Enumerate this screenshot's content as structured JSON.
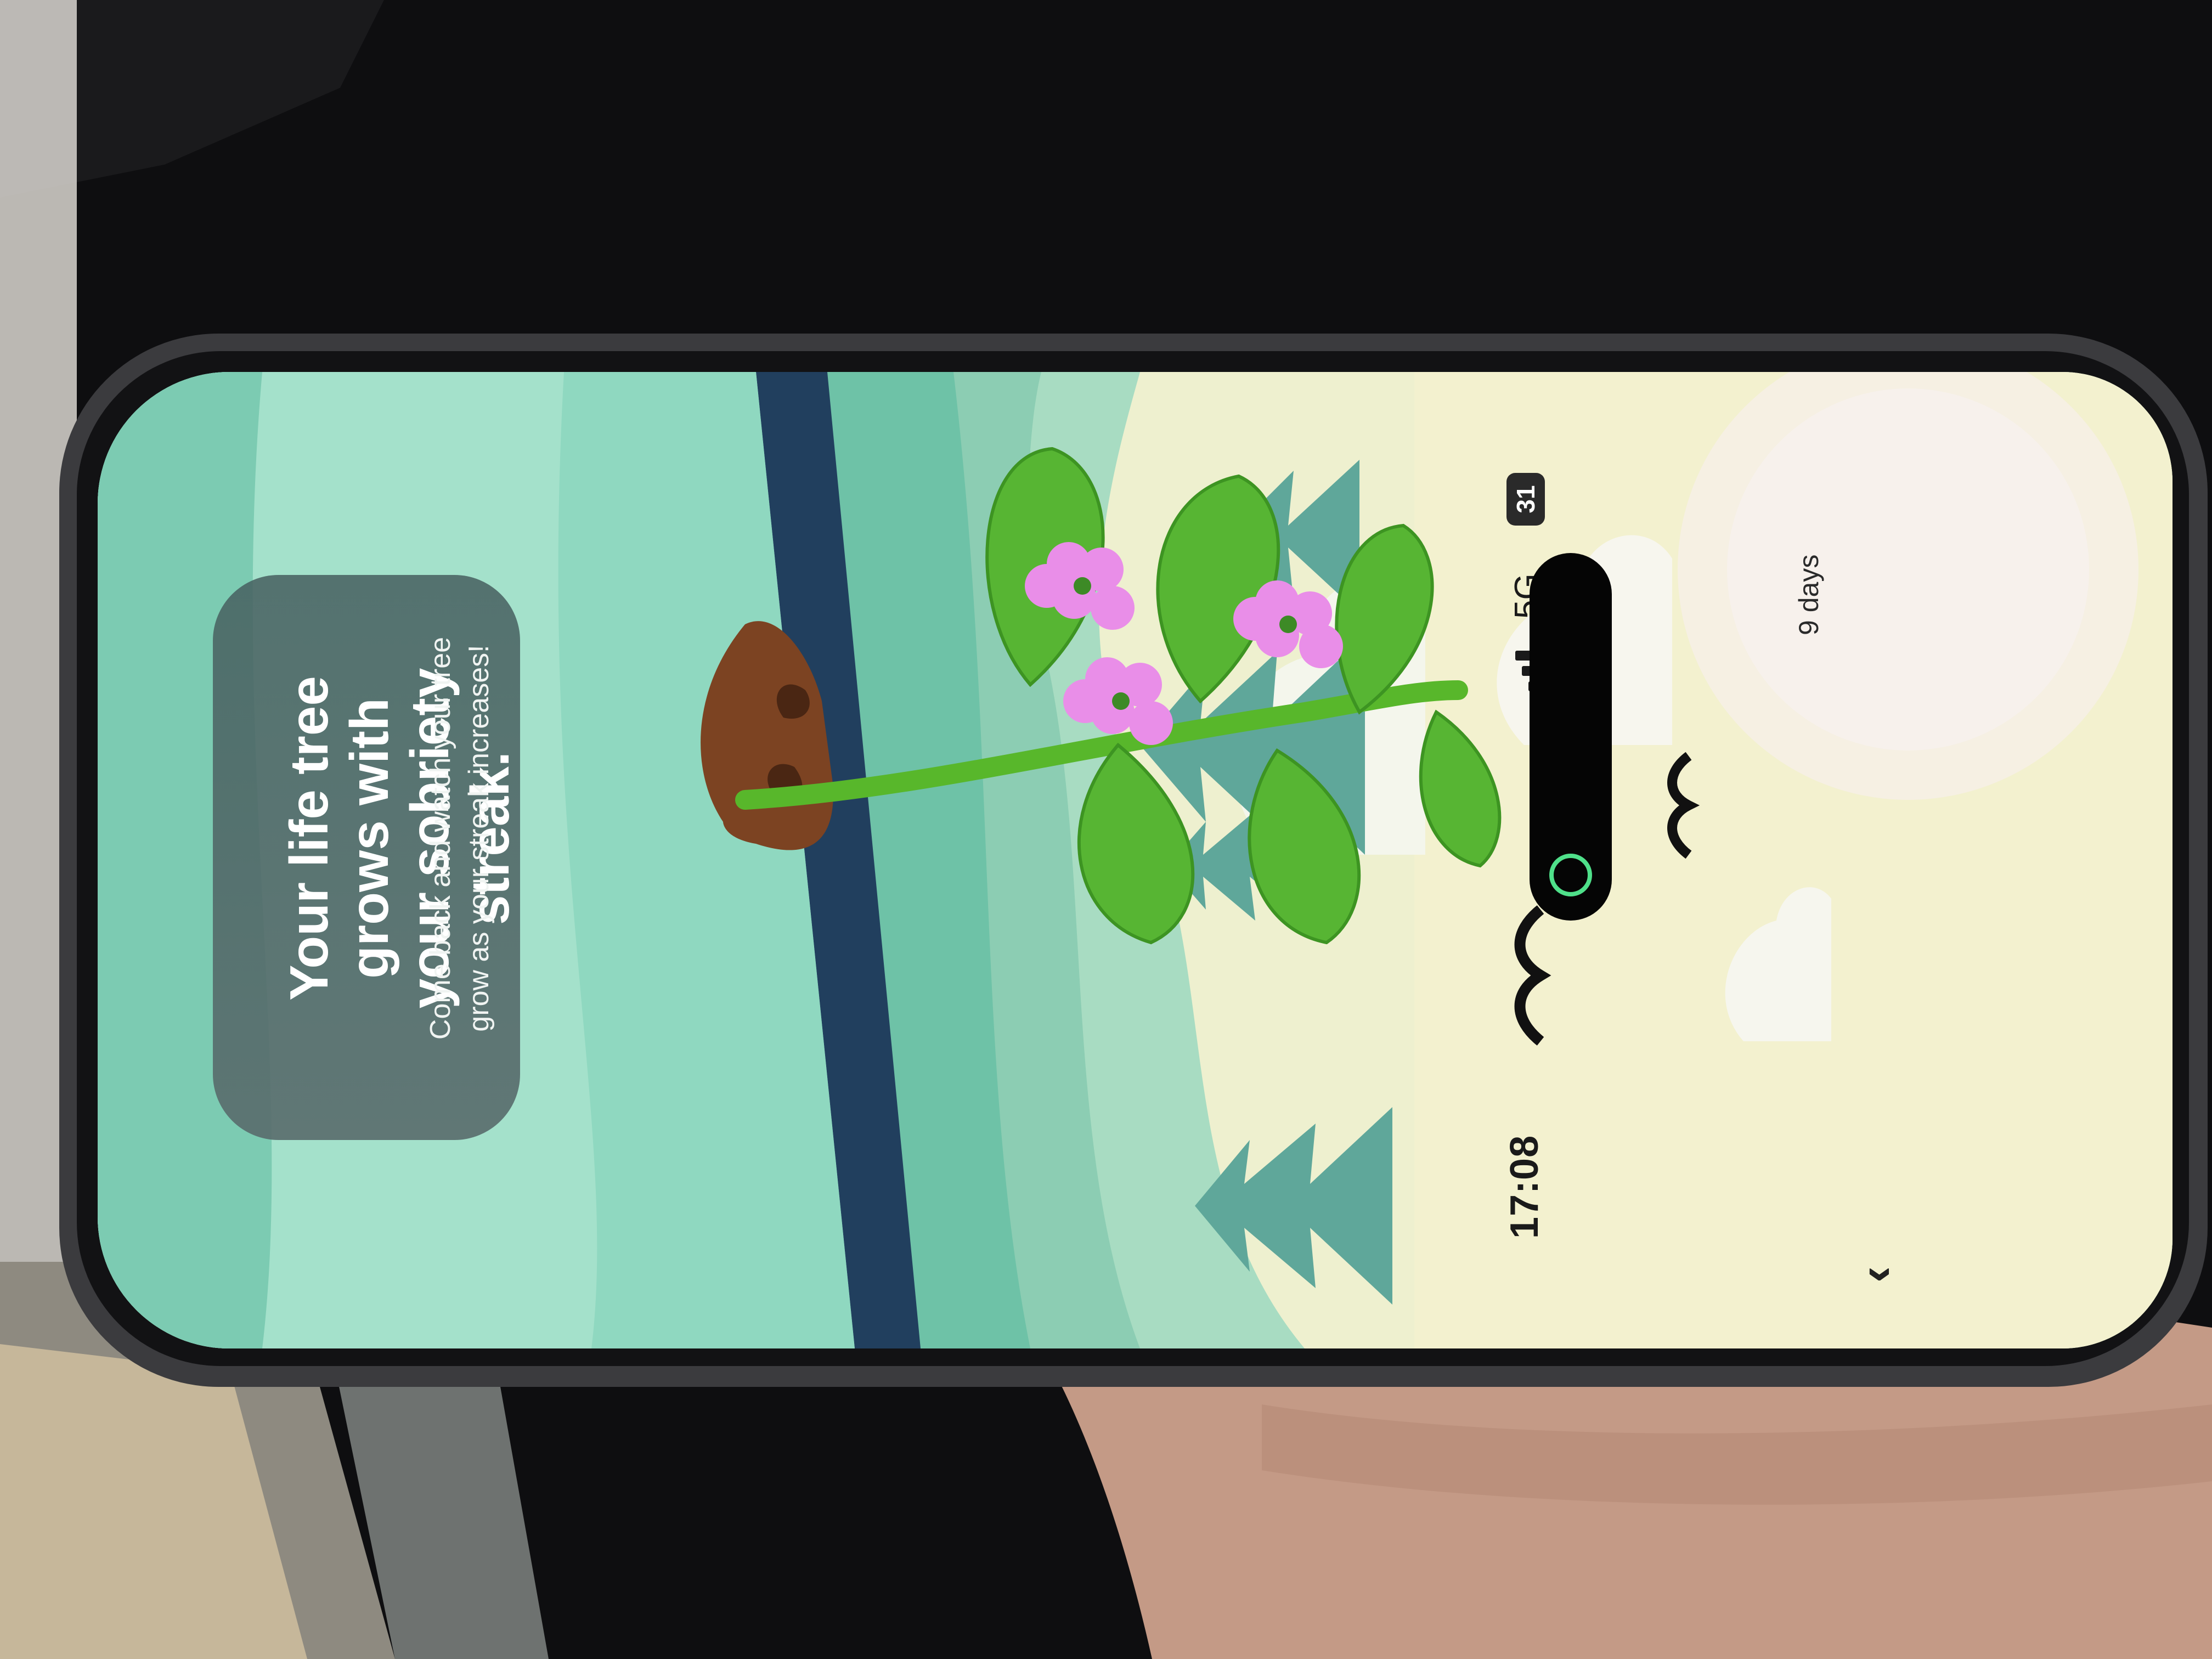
{
  "status_bar": {
    "time": "17:08",
    "network": "5G",
    "battery": "31"
  },
  "streak": {
    "days_label": "9 days"
  },
  "nav": {
    "back_glyph": "‹"
  },
  "card": {
    "title": "Your life tree grows with your sobriety streak.",
    "subtitle": "Come back and watch your tree grow as your streak increases!"
  },
  "colors": {
    "sky": "#eef0cf",
    "ground": "#7fcfb3",
    "leaf": "#5cb83a",
    "flower": "#e98ee8",
    "soil": "#7c4322"
  },
  "icons": [
    "back-chevron-icon",
    "signal-icon",
    "battery-icon",
    "island-app-icon"
  ]
}
